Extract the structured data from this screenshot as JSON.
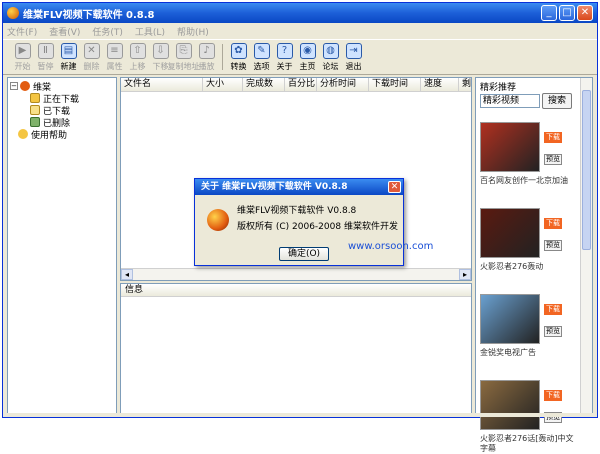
{
  "window": {
    "title": "维棠FLV视频下载软件 0.8.8"
  },
  "menu": [
    "文件(F)",
    "查看(V)",
    "任务(T)",
    "工具(L)",
    "帮助(H)"
  ],
  "toolbar": [
    {
      "label": "开始",
      "icon": "play-icon",
      "glyph": "▶",
      "enabled": false
    },
    {
      "label": "暂停",
      "icon": "pause-icon",
      "glyph": "Ⅱ",
      "enabled": false
    },
    {
      "label": "新建",
      "icon": "new-file-icon",
      "glyph": "▤",
      "enabled": true
    },
    {
      "label": "删除",
      "icon": "delete-icon",
      "glyph": "✕",
      "enabled": false
    },
    {
      "label": "属性",
      "icon": "properties-icon",
      "glyph": "≡",
      "enabled": false
    },
    {
      "label": "上移",
      "icon": "move-up-icon",
      "glyph": "⇧",
      "enabled": false
    },
    {
      "label": "下移",
      "icon": "move-down-icon",
      "glyph": "⇩",
      "enabled": false
    },
    {
      "label": "复制地址",
      "icon": "copy-address-icon",
      "glyph": "⎘",
      "enabled": false
    },
    {
      "label": "播放",
      "icon": "player-icon",
      "glyph": "♪",
      "enabled": false
    },
    {
      "label": "转换",
      "icon": "convert-icon",
      "glyph": "✿",
      "enabled": true
    },
    {
      "label": "选项",
      "icon": "options-icon",
      "glyph": "✎",
      "enabled": true
    },
    {
      "label": "关于",
      "icon": "about-icon",
      "glyph": "?",
      "enabled": true
    },
    {
      "label": "主页",
      "icon": "home-icon",
      "glyph": "◉",
      "enabled": true
    },
    {
      "label": "论坛",
      "icon": "forum-icon",
      "glyph": "◍",
      "enabled": true
    },
    {
      "label": "退出",
      "icon": "exit-icon",
      "glyph": "⇥",
      "enabled": true
    }
  ],
  "tree": {
    "root": "维棠",
    "items": [
      "正在下载",
      "已下载",
      "已删除"
    ],
    "help": "使用帮助"
  },
  "list": {
    "columns": [
      "文件名",
      "大小",
      "完成数",
      "百分比",
      "分析时间",
      "下载时间",
      "速度",
      "剩"
    ]
  },
  "info": {
    "header": "信息"
  },
  "side": {
    "title": "精彩推荐",
    "search_value": "精彩视频",
    "search_button": "搜索",
    "download_label": "下载",
    "preview_label": "预览",
    "videos": [
      {
        "caption": "百名网友创作一北京加油",
        "color": "#b03020"
      },
      {
        "caption": "火影忍者276轰动",
        "color": "#5a1a10"
      },
      {
        "caption": "金锐奖电视广告",
        "color": "#6aa0d0"
      },
      {
        "caption": "火影忍者276话[轰动]中文字幕",
        "color": "#8a6a40"
      }
    ]
  },
  "dialog": {
    "title": "关于 维棠FLV视频下载软件 V0.8.8",
    "line1": "维棠FLV视频下载软件 V0.8.8",
    "line2": "版权所有 (C) 2006-2008 维棠软件开发",
    "ok": "确定(O)"
  },
  "watermark": "www.orsoon.com",
  "colors": {
    "titlebar": "#0a47c4",
    "accent": "#f26522"
  }
}
